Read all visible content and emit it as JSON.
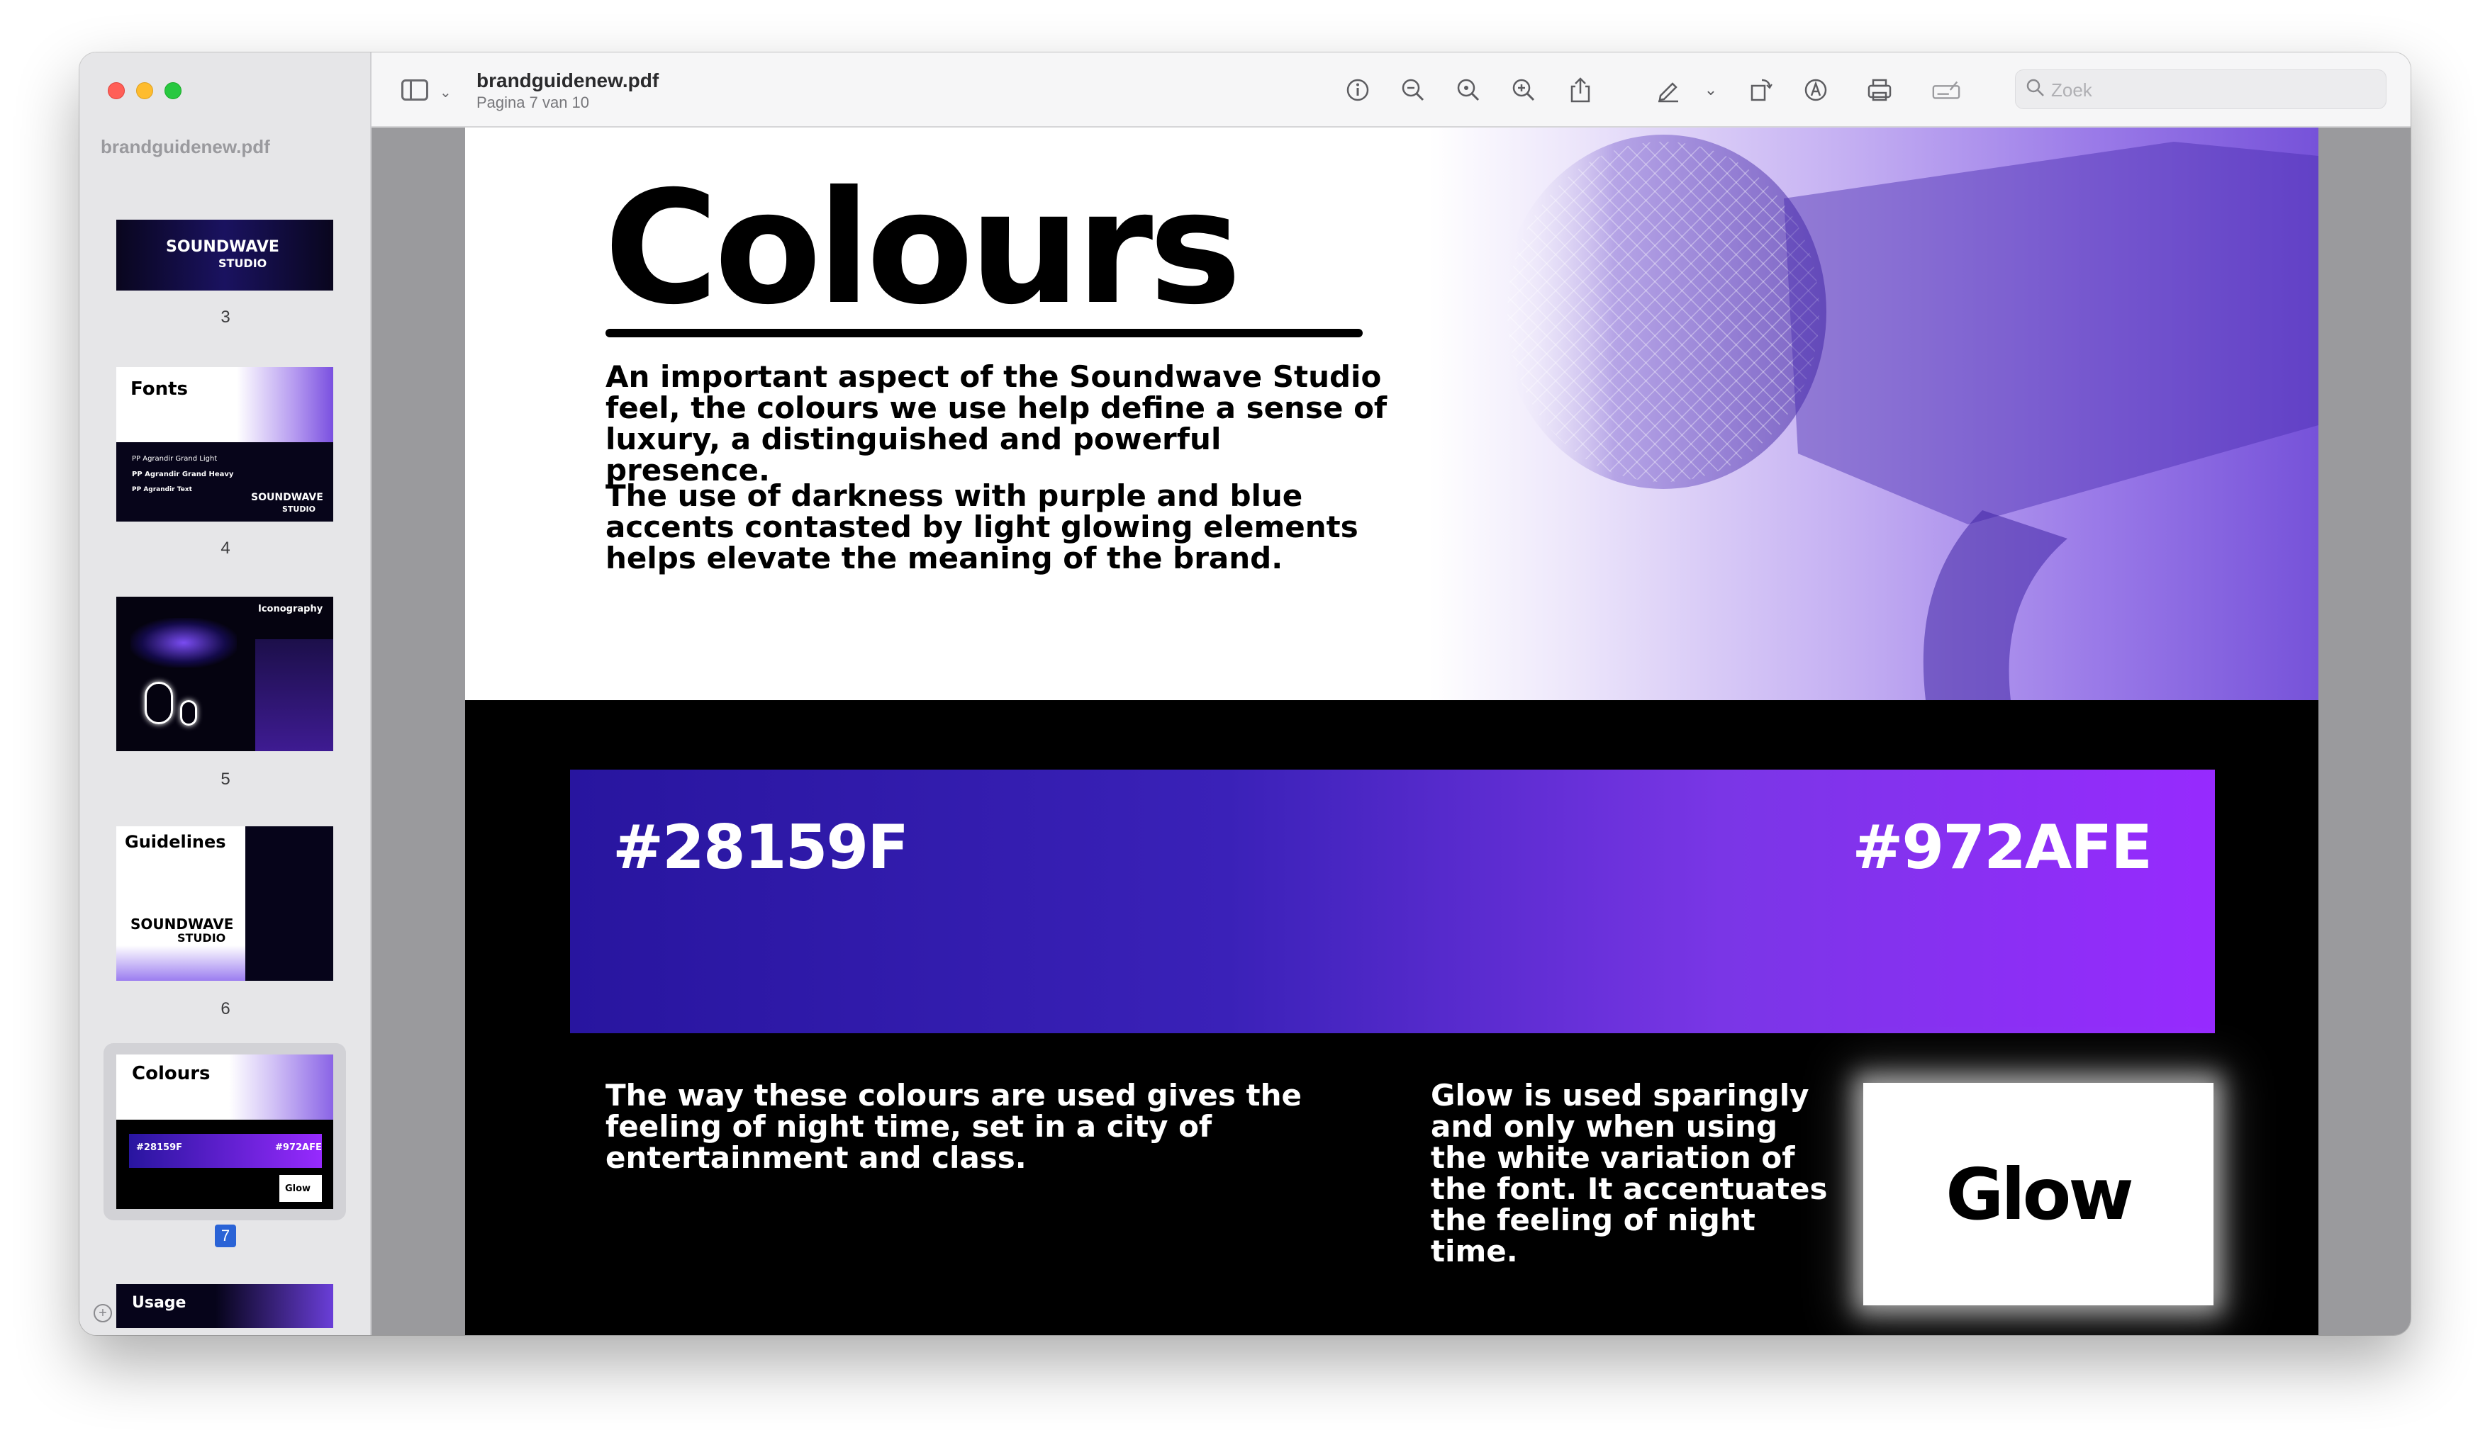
{
  "window": {
    "sidebar_title": "brandguidenew.pdf",
    "doc_name": "brandguidenew.pdf",
    "page_indicator": "Pagina 7 van 10"
  },
  "search": {
    "placeholder": "Zoek"
  },
  "toolbar_icons": [
    "sidebar-toggle-icon",
    "chevron-down-icon",
    "info-icon",
    "zoom-out-icon",
    "zoom-fit-icon",
    "zoom-in-icon",
    "share-icon",
    "markup-pen-icon",
    "chevron-down-icon",
    "rotate-icon",
    "annotate-icon",
    "print-icon",
    "form-fill-icon",
    "search-icon"
  ],
  "thumbnails": [
    {
      "page": "3",
      "lines": [
        "SOUNDWAVE",
        "STUDIO"
      ]
    },
    {
      "page": "4",
      "title": "Fonts",
      "lines": [
        "PP Agrandir Grand Light",
        "PP Agrandir Grand Heavy",
        "PP Agrandir Text",
        "SOUNDWAVE",
        "STUDIO"
      ]
    },
    {
      "page": "5",
      "title": "Iconography"
    },
    {
      "page": "6",
      "title": "Guidelines",
      "lines": [
        "SOUNDWAVE",
        "STUDIO"
      ]
    },
    {
      "page": "7",
      "title": "Colours",
      "lines": [
        "#28159F",
        "#972AFE",
        "Glow"
      ],
      "selected": true
    },
    {
      "page": "8",
      "title": "Usage"
    }
  ],
  "slide": {
    "title": "Colours",
    "para1": "An important aspect of the Soundwave Studio feel, the colours we use help define a sense of luxury, a distinguished and powerful presence.",
    "para2": "The use of darkness with purple and blue accents contasted by light glowing elements helps elevate the meaning of the brand.",
    "hex_left": "#28159F",
    "hex_right": "#972AFE",
    "bottom_left": "The way these colours are used gives the feeling of night time, set in a city of entertainment and class.",
    "bottom_middle": "Glow is used sparingly and only when using the white variation of the font. It accentuates the feeling of night time.",
    "glow_word": "Glow"
  },
  "colors": {
    "primary_dark": "#28159F",
    "primary_light": "#972AFE"
  }
}
